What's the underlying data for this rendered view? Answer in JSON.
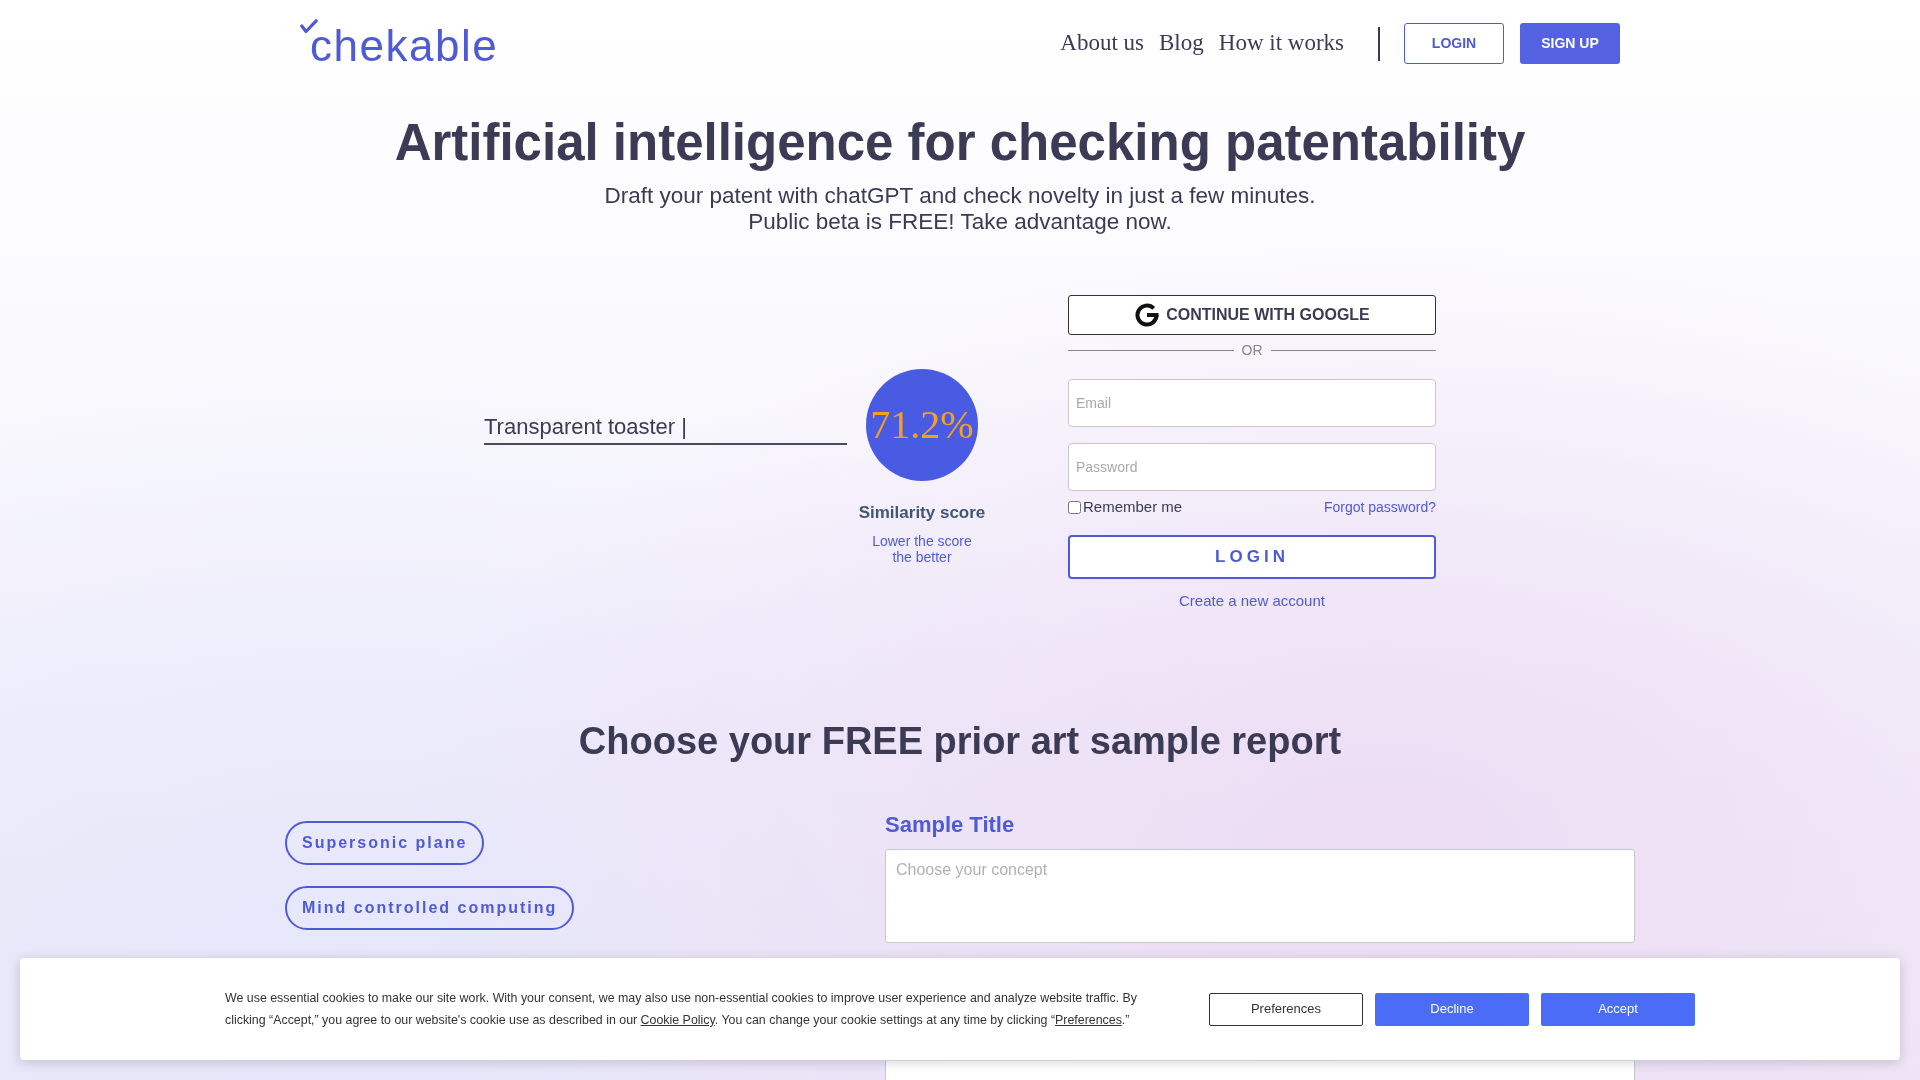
{
  "header": {
    "logo": "chekable",
    "nav": [
      "About us",
      "Blog",
      "How it works"
    ],
    "login_button": "LOGIN",
    "signup_button": "SIGN UP"
  },
  "hero": {
    "title": "Artificial intelligence for checking patentability",
    "subtitle_lines": [
      "Draft your patent with chatGPT and check novelty in just a few minutes.",
      "Public beta is FREE! Take advantage now."
    ]
  },
  "demo": {
    "query": "Transparent toaster |",
    "score": "71.2%",
    "score_label": "Similarity score",
    "hint_lines": [
      "Lower the score",
      "the better"
    ]
  },
  "login_form": {
    "google_button": "CONTINUE WITH GOOGLE",
    "divider": "OR",
    "email": {
      "placeholder": "Email"
    },
    "password": {
      "placeholder": "Password"
    },
    "remember": {
      "label": "Remember me",
      "checked": false
    },
    "forgot_link": "Forgot password?",
    "submit": "LOGIN",
    "create_account": "Create a new account"
  },
  "samples": {
    "title": "Choose your FREE prior art sample report",
    "chips": [
      "Supersonic plane",
      "Mind controlled computing"
    ],
    "field_label": "Sample Title",
    "field": {
      "placeholder": "Choose your concept"
    }
  },
  "cookie_banner": {
    "text_parts": [
      {
        "kind": "text",
        "text": "We use essential cookies to make our site work. With your consent, we may also use non-essential cookies to improve user experience and analyze website traffic. By clicking “Accept,” you agree to our website's cookie use as described in our "
      },
      {
        "kind": "link",
        "text": "Cookie Policy"
      },
      {
        "kind": "text",
        "text": ". You can change your cookie settings at any time by clicking “"
      },
      {
        "kind": "link",
        "text": "Preferences"
      },
      {
        "kind": "text",
        "text": ".”"
      }
    ],
    "buttons": [
      {
        "label": "Preferences",
        "kind": "outline"
      },
      {
        "label": "Decline",
        "kind": "primary"
      },
      {
        "label": "Accept",
        "kind": "primary"
      }
    ]
  }
}
